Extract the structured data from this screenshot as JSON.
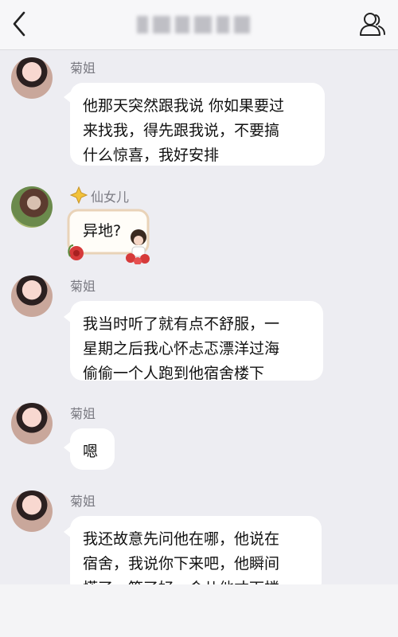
{
  "header": {
    "back_icon": "chevron-left-icon",
    "profile_icon": "person-icon"
  },
  "messages": [
    {
      "sender": "菊姐",
      "text": "他那天突然跟我说 你如果要过\n来找我，得先跟我说，不要搞\n什么惊喜，我好安排"
    },
    {
      "sender": "仙女儿",
      "badge_icon": "diamond-star-icon",
      "text": "异地?"
    },
    {
      "sender": "菊姐",
      "text": "我当时听了就有点不舒服，一\n星期之后我心怀忐忑漂洋过海\n偷偷一个人跑到他宿舍楼下"
    },
    {
      "sender": "菊姐",
      "text": "嗯"
    },
    {
      "sender": "菊姐",
      "text": "我还故意先问他在哪，他说在\n宿舍，我说你下来吧，他瞬间\n慌了，等了好一会儿他才下楼"
    }
  ],
  "colors": {
    "background": "#ededf2",
    "bubble": "#ffffff",
    "badge": "#f2c23a",
    "sticker_frame": "#e9d3b8",
    "rose": "#d63a3a"
  }
}
